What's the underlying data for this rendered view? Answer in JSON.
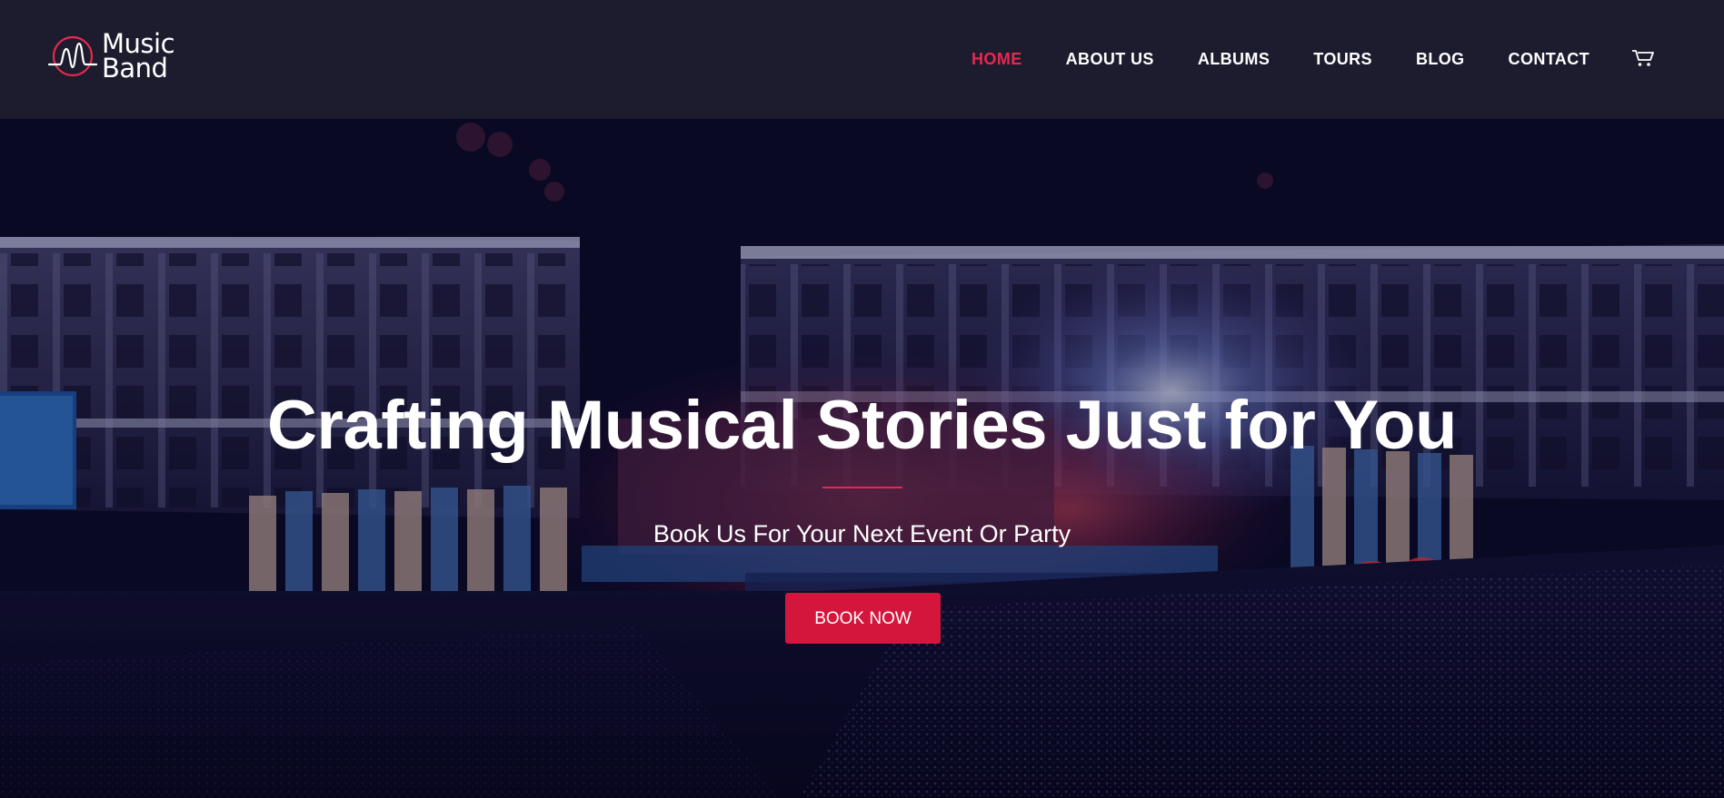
{
  "header": {
    "logo": {
      "line1": "Music",
      "line2": "Band",
      "icon": "waveform-circle-icon"
    },
    "nav": [
      {
        "label": "HOME",
        "active": true
      },
      {
        "label": "ABOUT US",
        "active": false
      },
      {
        "label": "ALBUMS",
        "active": false
      },
      {
        "label": "TOURS",
        "active": false
      },
      {
        "label": "BLOG",
        "active": false
      },
      {
        "label": "CONTACT",
        "active": false
      }
    ],
    "cart_icon": "cart-icon"
  },
  "hero": {
    "title": "Crafting Musical Stories Just for You",
    "subtitle": "Book Us For Your Next Event Or Party",
    "button_label": "BOOK NOW",
    "background_image": "aerial night concert stage in a town square with crowd"
  },
  "colors": {
    "accent": "#e8284f",
    "button": "#d4163c",
    "header_bg": "#1c1c2e",
    "hero_bg": "#0b0a22"
  }
}
